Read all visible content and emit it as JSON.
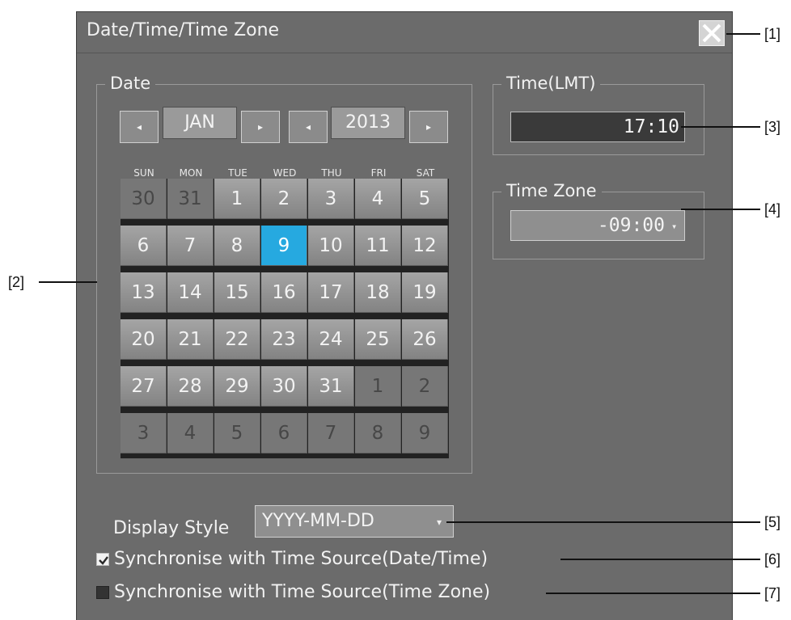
{
  "dialog": {
    "title": "Date/Time/Time Zone"
  },
  "date_group": {
    "label": "Date",
    "month_value": "JAN",
    "year_value": "2013",
    "prev_glyph": "◂",
    "next_glyph": "▸",
    "weekdays": [
      "SUN",
      "MON",
      "TUE",
      "WED",
      "THU",
      "FRI",
      "SAT"
    ],
    "days": [
      [
        "30",
        "31",
        "1",
        "2",
        "3",
        "4",
        "5"
      ],
      [
        "6",
        "7",
        "8",
        "9",
        "10",
        "11",
        "12"
      ],
      [
        "13",
        "14",
        "15",
        "16",
        "17",
        "18",
        "19"
      ],
      [
        "20",
        "21",
        "22",
        "23",
        "24",
        "25",
        "26"
      ],
      [
        "27",
        "28",
        "29",
        "30",
        "31",
        "1",
        "2"
      ],
      [
        "3",
        "4",
        "5",
        "6",
        "7",
        "8",
        "9"
      ]
    ],
    "selected_day": "9"
  },
  "time_group": {
    "label": "Time(LMT)",
    "value": "17:10"
  },
  "zone_group": {
    "label": "Time Zone",
    "value": "-09:00"
  },
  "display_style": {
    "label": "Display Style",
    "value": "YYYY-MM-DD"
  },
  "sync_datetime": {
    "label": "Synchronise with Time Source(Date/Time)",
    "checked": true
  },
  "sync_zone": {
    "label": "Synchronise with Time Source(Time Zone)",
    "checked": false
  },
  "callouts": [
    "[1]",
    "[2]",
    "[3]",
    "[4]",
    "[5]",
    "[6]",
    "[7]"
  ],
  "colors": {
    "dialog_bg": "#6b6b6b",
    "selected_day": "#26a9e0"
  },
  "icons": {
    "close": "close-icon",
    "caret": "chevron-down-icon",
    "check": "checkmark-icon"
  }
}
